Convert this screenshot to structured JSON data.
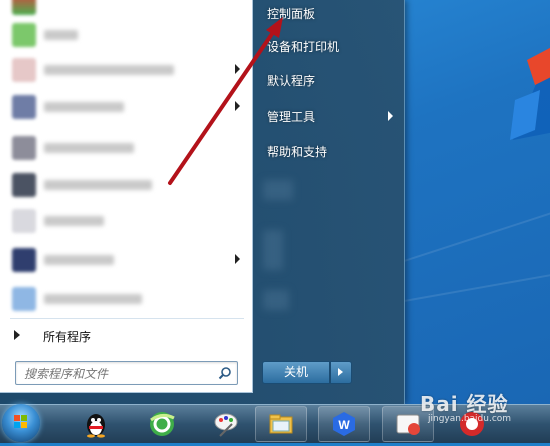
{
  "start_menu": {
    "all_programs_label": "所有程序",
    "search_placeholder": "搜索程序和文件",
    "right_items": [
      {
        "label": "控制面板",
        "has_submenu": false
      },
      {
        "label": "设备和打印机",
        "has_submenu": false
      },
      {
        "label": "默认程序",
        "has_submenu": false
      },
      {
        "label": "管理工具",
        "has_submenu": true
      },
      {
        "label": "帮助和支持",
        "has_submenu": false
      }
    ],
    "shutdown_label": "关机"
  },
  "taskbar": {
    "icons": [
      "start-orb",
      "qq-penguin-icon",
      "browser-icon",
      "paint-icon",
      "file-explorer-icon",
      "wps-icon",
      "app-icon",
      "red-app-icon"
    ],
    "wps_letter": "W"
  },
  "watermark": {
    "main": "Bai 经验",
    "sub": "jingyan.baidu.com"
  },
  "colors": {
    "annotation_arrow": "#b3121a",
    "desktop_blue": "#1e73c1"
  }
}
